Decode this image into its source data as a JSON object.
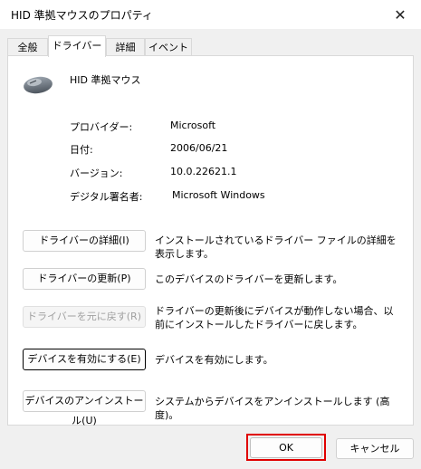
{
  "window": {
    "title": "HID 準拠マウスのプロパティ",
    "close_icon": "✕"
  },
  "tabs": [
    {
      "label": "全般"
    },
    {
      "label": "ドライバー"
    },
    {
      "label": "詳細"
    },
    {
      "label": "イベント"
    }
  ],
  "device": {
    "name": "HID 準拠マウス",
    "icon": "mouse-icon"
  },
  "info": {
    "provider_label": "プロバイダー:",
    "provider_value": "Microsoft",
    "date_label": "日付:",
    "date_value": "2006/06/21",
    "version_label": "バージョン:",
    "version_value": "10.0.22621.1",
    "signer_label": "デジタル署名者:",
    "signer_value": "Microsoft Windows"
  },
  "actions": [
    {
      "button": "ドライバーの詳細(I)",
      "description": "インストールされているドライバー ファイルの詳細を表示します。"
    },
    {
      "button": "ドライバーの更新(P)",
      "description": "このデバイスのドライバーを更新します。"
    },
    {
      "button": "ドライバーを元に戻す(R)",
      "description": "ドライバーの更新後にデバイスが動作しない場合、以前にインストールしたドライバーに戻します。"
    },
    {
      "button": "デバイスを有効にする(E)",
      "description": "デバイスを有効にします。"
    },
    {
      "button": "デバイスのアンインストール(U)",
      "description": "システムからデバイスをアンインストールします (高度)。"
    }
  ],
  "footer": {
    "ok": "OK",
    "cancel": "キャンセル"
  },
  "colors": {
    "highlight": "#e00000",
    "panel": "#ffffff",
    "background": "#f0f0f0"
  }
}
